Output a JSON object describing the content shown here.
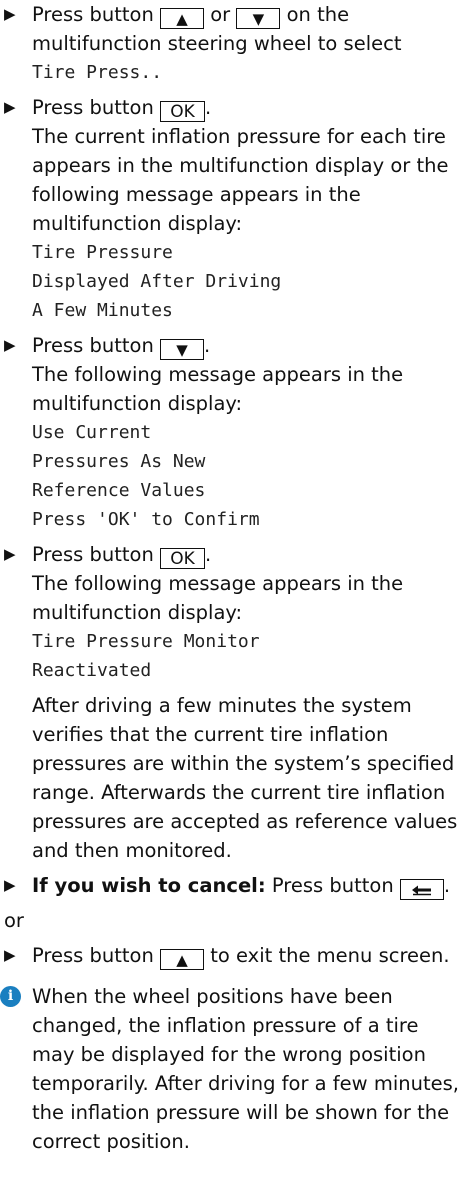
{
  "steps": [
    {
      "pre": "Press button",
      "mid": "or",
      "post": "on the multifunction steering wheel to select",
      "display": [
        "Tire Press.."
      ]
    },
    {
      "pre": "Press button",
      "key": "OK",
      "post": ".",
      "text": "The current inflation pressure for each tire appears in the multifunction display or the following message appears in the multifunction display:",
      "display": [
        "Tire Pressure",
        "Displayed After Driving",
        "A Few Minutes"
      ]
    },
    {
      "pre": "Press button",
      "post": ".",
      "text": "The following message appears in the multifunction display:",
      "display": [
        "Use Current",
        "Pressures As New",
        "Reference Values",
        "Press 'OK' to Confirm"
      ]
    },
    {
      "pre": "Press button",
      "key": "OK",
      "post": ".",
      "text": "The following message appears in the multifunction display:",
      "display": [
        "Tire Pressure Monitor",
        "Reactivated"
      ],
      "after": "After driving a few minutes the system verifies that the current tire inflation pressures are within the system’s specified range. Afterwards the current tire inflation pressures are accepted as reference values and then monitored."
    },
    {
      "bold": "If you wish to cancel:",
      "pre": "Press button",
      "post": "."
    },
    {
      "or": "or"
    },
    {
      "pre": "Press button",
      "post": "to exit the menu screen."
    }
  ],
  "note": "When the wheel positions have been changed, the inflation pressure of a tire may be displayed for the wrong position temporarily. After driving for a few minutes, the inflation pressure will be shown for the correct position.",
  "icons": {
    "step_marker": "triangle-right",
    "up": "up-triangle",
    "down": "down-triangle",
    "back": "back-arrow",
    "info": "info-circle"
  },
  "colors": {
    "text": "#111111",
    "info": "#1a7fc0"
  }
}
